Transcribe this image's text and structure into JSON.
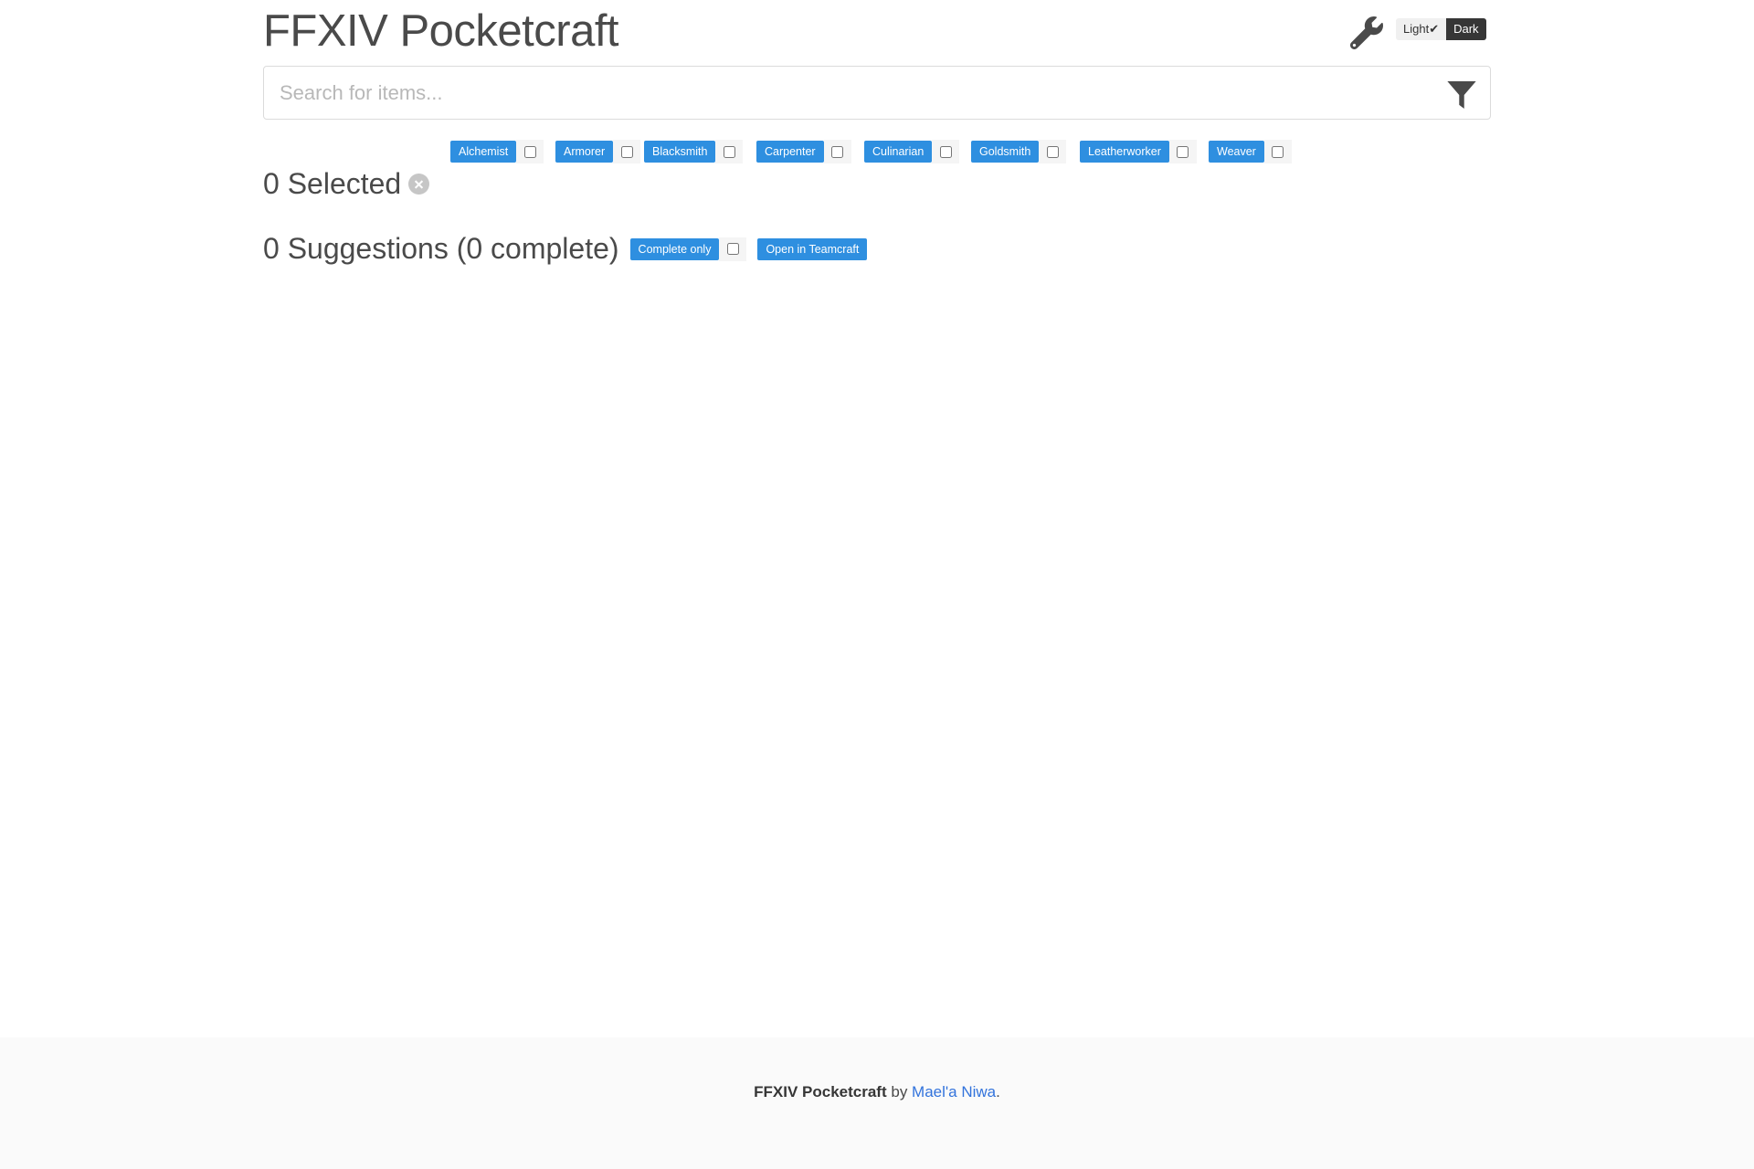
{
  "app": {
    "title": "FFXIV Pocketcraft"
  },
  "theme_toggle": {
    "light_label": "Light✔",
    "dark_label": "Dark"
  },
  "icons": {
    "settings": "wrench-icon",
    "filter": "filter-icon",
    "clear": "close-circle-icon"
  },
  "search": {
    "placeholder": "Search for items...",
    "value": ""
  },
  "jobs": [
    {
      "label": "Alchemist",
      "checked": false
    },
    {
      "label": "Armorer",
      "checked": false
    },
    {
      "label": "Blacksmith",
      "checked": false
    },
    {
      "label": "Carpenter",
      "checked": false
    },
    {
      "label": "Culinarian",
      "checked": false
    },
    {
      "label": "Goldsmith",
      "checked": false
    },
    {
      "label": "Leatherworker",
      "checked": false
    },
    {
      "label": "Weaver",
      "checked": false
    }
  ],
  "selected": {
    "heading": "0 Selected"
  },
  "suggestions": {
    "heading": "0 Suggestions (0 complete)",
    "complete_only_label": "Complete only",
    "complete_only_checked": false,
    "teamcraft_label": "Open in Teamcraft"
  },
  "footer": {
    "app_name": "FFXIV Pocketcraft",
    "by_text": " by ",
    "author": "Mael'a Niwa",
    "end": "."
  },
  "colors": {
    "accent": "#2e8fe0",
    "text": "#4a4a4a",
    "footer_bg": "#fafafa",
    "link": "#3273dc",
    "dark_toggle": "#363636"
  }
}
